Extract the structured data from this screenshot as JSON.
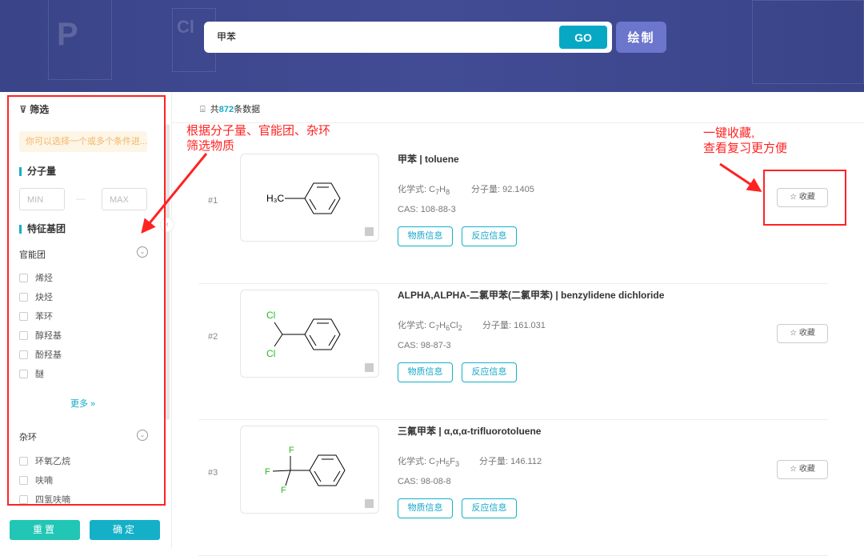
{
  "search": {
    "value": "甲苯",
    "go": "GO",
    "draw": "绘制"
  },
  "sidebar": {
    "title": "筛选",
    "tip": "你可以选择一个或多个条件进...",
    "mw_section": "分子量",
    "min": "MIN",
    "max": "MAX",
    "sep": "—",
    "feature_section": "特征基团",
    "groups": [
      {
        "label": "官能团",
        "items": [
          "烯烃",
          "炔烃",
          "苯环",
          "醇羟基",
          "酚羟基",
          "醚"
        ],
        "more": "更多"
      },
      {
        "label": "杂环",
        "items": [
          "环氧乙烷",
          "呋喃",
          "四氢呋喃"
        ]
      }
    ],
    "reset": "重置",
    "confirm": "确定"
  },
  "results": {
    "prefix": "共",
    "count": "872",
    "suffix": "条数据",
    "formula_label": "化学式: ",
    "mw_label": "分子量: ",
    "cas_label": "CAS: ",
    "info_btn": "物质信息",
    "rxn_btn": "反应信息",
    "fav_btn": "收藏",
    "items": [
      {
        "index": "#1",
        "name": "甲苯 | toluene",
        "formula": "C7H8",
        "mw": "92.1405",
        "cas": "108-88-3",
        "sub": "H₃C"
      },
      {
        "index": "#2",
        "name": "ALPHA,ALPHA-二氯甲苯(二氯甲苯) | benzylidene dichloride",
        "formula": "C7H6Cl2",
        "mw": "161.031",
        "cas": "98-87-3",
        "sub": "Cl"
      },
      {
        "index": "#3",
        "name": "三氟甲苯 | α,α,α-trifluorotoluene",
        "formula": "C7H5F3",
        "mw": "146.112",
        "cas": "98-08-8",
        "sub": "F"
      }
    ]
  },
  "annotations": {
    "left": [
      "根据分子量、官能团、杂环",
      "筛选物质"
    ],
    "right": [
      "一键收藏,",
      "查看复习更方便"
    ]
  },
  "colors": {
    "accent": "#14b0c8",
    "header": "#3f4a8f",
    "annotation": "#ff2222"
  }
}
